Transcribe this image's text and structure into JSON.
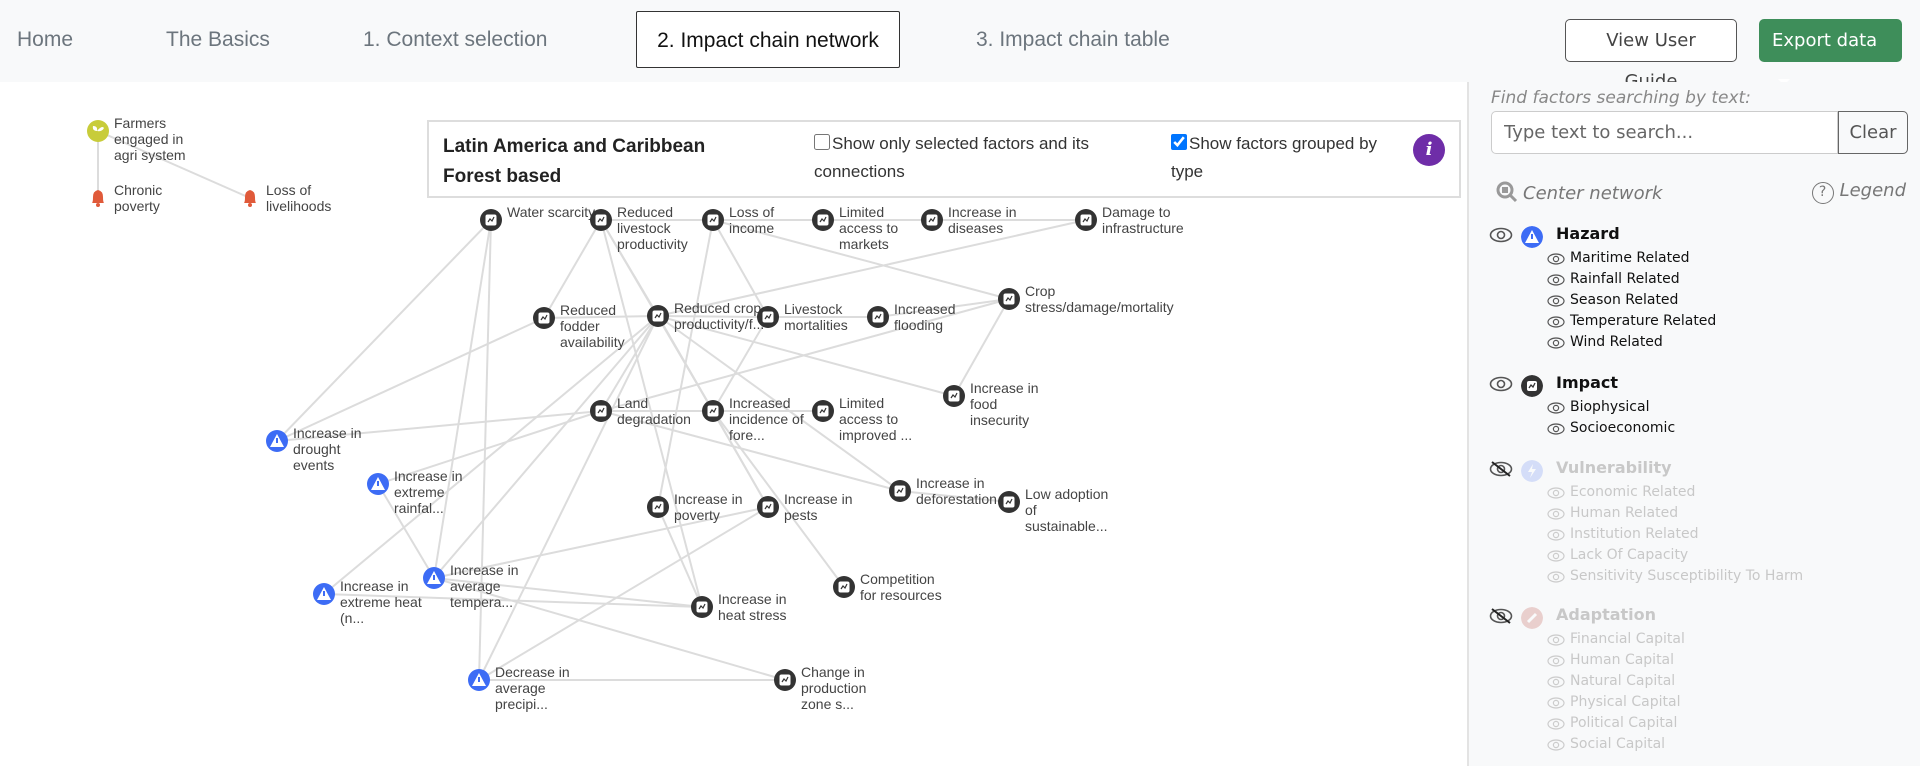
{
  "nav": {
    "tabs": [
      {
        "label": "Home"
      },
      {
        "label": "The Basics"
      },
      {
        "label": "1. Context selection"
      },
      {
        "label": "2. Impact chain network",
        "active": true
      },
      {
        "label": "3. Impact chain table"
      }
    ],
    "guide_label": "View User Guide",
    "export_label": "Export data"
  },
  "panel": {
    "title_line1": "Latin America and Caribbean",
    "title_line2": "Forest based",
    "only_selected": {
      "label": "Show only selected factors and its connections",
      "checked": false
    },
    "grouped": {
      "label": "Show factors grouped by type",
      "checked": true
    },
    "info": "i"
  },
  "colors": {
    "hazard": "#3d6cf5",
    "impact": "#333333",
    "vulnerability": "#6b8cf5",
    "adaptation": "#c0554a",
    "outcome": "#c8cc3a",
    "risk": "#e05a3a",
    "export": "#3e8e5a",
    "info": "#6f2da8"
  },
  "network": {
    "nodes": [
      {
        "id": "farmers",
        "type": "outcome",
        "lines": [
          "Farmers",
          "engaged in",
          "agri system"
        ]
      },
      {
        "id": "chronic",
        "type": "risk",
        "lines": [
          "Chronic",
          "poverty"
        ]
      },
      {
        "id": "livelihoods",
        "type": "risk",
        "lines": [
          "Loss of",
          "livelihoods"
        ]
      },
      {
        "id": "water",
        "type": "impact",
        "lines": [
          "Water scarcity"
        ]
      },
      {
        "id": "livestockprod",
        "type": "impact",
        "lines": [
          "Reduced",
          "livestock",
          "productivity"
        ]
      },
      {
        "id": "income",
        "type": "impact",
        "lines": [
          "Loss of",
          "income"
        ]
      },
      {
        "id": "markets",
        "type": "impact",
        "lines": [
          "Limited",
          "access to",
          "markets"
        ]
      },
      {
        "id": "diseases",
        "type": "impact",
        "lines": [
          "Increase in",
          "diseases"
        ]
      },
      {
        "id": "infra",
        "type": "impact",
        "lines": [
          "Damage to",
          "infrastructure"
        ]
      },
      {
        "id": "fodder",
        "type": "impact",
        "lines": [
          "Reduced",
          "fodder",
          "availability"
        ]
      },
      {
        "id": "crop",
        "type": "impact",
        "lines": [
          "Reduced crop",
          "productivity/f..."
        ]
      },
      {
        "id": "mort",
        "type": "impact",
        "lines": [
          "Livestock",
          "mortalities"
        ]
      },
      {
        "id": "flood",
        "type": "impact",
        "lines": [
          "Increased",
          "flooding"
        ]
      },
      {
        "id": "cropstress",
        "type": "impact",
        "lines": [
          "Crop",
          "stress/damage/mortality"
        ]
      },
      {
        "id": "land",
        "type": "impact",
        "lines": [
          "Land",
          "degradation"
        ]
      },
      {
        "id": "fire",
        "type": "impact",
        "lines": [
          "Increased",
          "incidence of",
          "fore..."
        ]
      },
      {
        "id": "improved",
        "type": "impact",
        "lines": [
          "Limited",
          "access to",
          "improved ..."
        ]
      },
      {
        "id": "food",
        "type": "impact",
        "lines": [
          "Increase in",
          "food",
          "insecurity"
        ]
      },
      {
        "id": "drought",
        "type": "hazard",
        "lines": [
          "Increase in",
          "drought",
          "events"
        ]
      },
      {
        "id": "rain",
        "type": "hazard",
        "lines": [
          "Increase in",
          "extreme",
          "rainfal..."
        ]
      },
      {
        "id": "defor",
        "type": "impact",
        "lines": [
          "Increase in",
          "deforestation"
        ]
      },
      {
        "id": "adopt",
        "type": "impact",
        "lines": [
          "Low adoption",
          "of",
          "sustainable..."
        ]
      },
      {
        "id": "poverty",
        "type": "impact",
        "lines": [
          "Increase in",
          "poverty"
        ]
      },
      {
        "id": "pests",
        "type": "impact",
        "lines": [
          "Increase in",
          "pests"
        ]
      },
      {
        "id": "compet",
        "type": "impact",
        "lines": [
          "Competition",
          "for resources"
        ]
      },
      {
        "id": "avgtemp",
        "type": "hazard",
        "lines": [
          "Increase in",
          "average",
          "tempera..."
        ]
      },
      {
        "id": "heat",
        "type": "hazard",
        "lines": [
          "Increase in",
          "extreme heat",
          "(n..."
        ]
      },
      {
        "id": "heatstress",
        "type": "impact",
        "lines": [
          "Increase in",
          "heat stress"
        ]
      },
      {
        "id": "precip",
        "type": "hazard",
        "lines": [
          "Decrease in",
          "average",
          "precipi..."
        ]
      },
      {
        "id": "zone",
        "type": "impact",
        "lines": [
          "Change in",
          "production",
          "zone s..."
        ]
      }
    ],
    "edges": [
      [
        "farmers",
        "chronic"
      ],
      [
        "farmers",
        "livelihoods"
      ],
      [
        "water",
        "drought"
      ],
      [
        "water",
        "avgtemp"
      ],
      [
        "water",
        "precip"
      ],
      [
        "livestockprod",
        "income"
      ],
      [
        "livestockprod",
        "fodder"
      ],
      [
        "livestockprod",
        "crop"
      ],
      [
        "livestockprod",
        "fire"
      ],
      [
        "livestockprod",
        "heatstress"
      ],
      [
        "income",
        "markets"
      ],
      [
        "income",
        "mort"
      ],
      [
        "income",
        "cropstress"
      ],
      [
        "income",
        "poverty"
      ],
      [
        "markets",
        "diseases"
      ],
      [
        "diseases",
        "infra"
      ],
      [
        "infra",
        "crop"
      ],
      [
        "fodder",
        "crop"
      ],
      [
        "fodder",
        "drought"
      ],
      [
        "crop",
        "mort"
      ],
      [
        "crop",
        "land"
      ],
      [
        "crop",
        "fire"
      ],
      [
        "crop",
        "pests"
      ],
      [
        "crop",
        "defor"
      ],
      [
        "crop",
        "food"
      ],
      [
        "crop",
        "heat"
      ],
      [
        "crop",
        "avgtemp"
      ],
      [
        "mort",
        "flood"
      ],
      [
        "mort",
        "fire"
      ],
      [
        "flood",
        "cropstress"
      ],
      [
        "cropstress",
        "food"
      ],
      [
        "cropstress",
        "land"
      ],
      [
        "land",
        "drought"
      ],
      [
        "land",
        "fire"
      ],
      [
        "land",
        "defor"
      ],
      [
        "land",
        "rain"
      ],
      [
        "fire",
        "improved"
      ],
      [
        "fire",
        "pests"
      ],
      [
        "fire",
        "compet"
      ],
      [
        "defor",
        "adopt"
      ],
      [
        "poverty",
        "heatstress"
      ],
      [
        "pests",
        "avgtemp"
      ],
      [
        "pests",
        "precip"
      ],
      [
        "avgtemp",
        "heatstress"
      ],
      [
        "heat",
        "heatstress"
      ],
      [
        "avgtemp",
        "zone"
      ],
      [
        "precip",
        "zone"
      ],
      [
        "rain",
        "avgtemp"
      ],
      [
        "precip",
        "crop"
      ]
    ]
  },
  "sidebar": {
    "find_label": "Find factors searching by text:",
    "search_placeholder": "Type text to search...",
    "search_value": "",
    "clear_label": "Clear",
    "center_label": "Center network",
    "legend_label": "Legend",
    "groups": [
      {
        "name": "Hazard",
        "visible": true,
        "icon": "warning-icon",
        "items": [
          "Maritime Related",
          "Rainfall Related",
          "Season Related",
          "Temperature Related",
          "Wind Related"
        ]
      },
      {
        "name": "Impact",
        "visible": true,
        "icon": "impact-icon",
        "items": [
          "Biophysical",
          "Socioeconomic"
        ]
      },
      {
        "name": "Vulnerability",
        "visible": false,
        "icon": "lightning-icon",
        "items": [
          "Economic Related",
          "Human Related",
          "Institution Related",
          "Lack Of Capacity",
          "Sensitivity Susceptibility To Harm"
        ]
      },
      {
        "name": "Adaptation",
        "visible": false,
        "icon": "wrench-icon",
        "items": [
          "Financial Capital",
          "Human Capital",
          "Natural Capital",
          "Physical Capital",
          "Political Capital",
          "Social Capital"
        ]
      }
    ]
  }
}
